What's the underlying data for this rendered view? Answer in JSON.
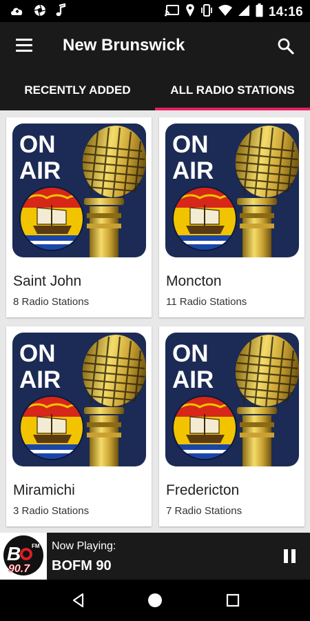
{
  "status_bar": {
    "time": "14:16",
    "icons_left": [
      "cloud-upload-icon",
      "aperture-icon",
      "music-note-icon"
    ],
    "icons_right": [
      "cast-icon",
      "location-icon",
      "vibrate-icon",
      "wifi-icon",
      "signal-icon",
      "battery-icon"
    ]
  },
  "app_bar": {
    "title": "New Brunswick",
    "menu_icon": "menu-icon",
    "search_icon": "search-icon"
  },
  "tabs": [
    {
      "label": "RECENTLY ADDED",
      "active": false
    },
    {
      "label": "ALL RADIO STATIONS",
      "active": true
    }
  ],
  "cards": [
    {
      "city": "Saint John",
      "count": "8 Radio Stations",
      "art_text": [
        "ON",
        "AIR"
      ]
    },
    {
      "city": "Moncton",
      "count": "11 Radio Stations",
      "art_text": [
        "ON",
        "AIR"
      ]
    },
    {
      "city": "Miramichi",
      "count": "3 Radio Stations",
      "art_text": [
        "ON",
        "AIR"
      ]
    },
    {
      "city": "Fredericton",
      "count": "7 Radio Stations",
      "art_text": [
        "ON",
        "AIR"
      ]
    }
  ],
  "player": {
    "label": "Now Playing:",
    "station": "BOFM 90",
    "logo_text": "BO FM 90.7",
    "pause_icon": "pause-icon"
  },
  "nav_bar": {
    "icons": [
      "back-icon",
      "home-icon",
      "recents-icon"
    ]
  },
  "colors": {
    "accent": "#e91e63",
    "app_bar_bg": "#1a1a1a",
    "grid_bg": "#e8e8e8",
    "art_bg": "#1c2b55"
  }
}
